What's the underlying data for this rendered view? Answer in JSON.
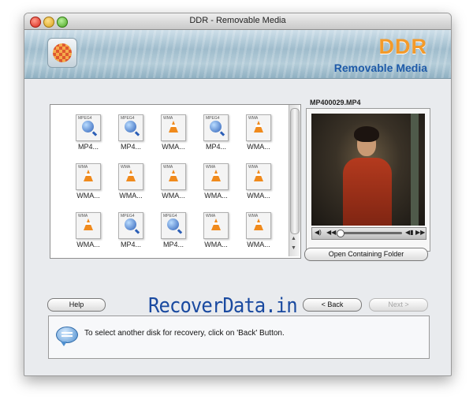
{
  "window": {
    "title": "DDR - Removable Media"
  },
  "header": {
    "brand": "DDR",
    "subtitle": "Removable Media"
  },
  "files": [
    {
      "label": "MP4...",
      "tag": "MPEG4",
      "type": "mp4"
    },
    {
      "label": "MP4...",
      "tag": "MPEG4",
      "type": "mp4"
    },
    {
      "label": "WMA...",
      "tag": "WMA",
      "type": "wma"
    },
    {
      "label": "MP4...",
      "tag": "MPEG4",
      "type": "mp4"
    },
    {
      "label": "WMA...",
      "tag": "WMA",
      "type": "wma"
    },
    {
      "label": "WMA...",
      "tag": "WMA",
      "type": "wma"
    },
    {
      "label": "WMA...",
      "tag": "WMA",
      "type": "wma"
    },
    {
      "label": "WMA...",
      "tag": "WMA",
      "type": "wma"
    },
    {
      "label": "WMA...",
      "tag": "WMA",
      "type": "wma"
    },
    {
      "label": "WMA...",
      "tag": "WMA",
      "type": "wma"
    },
    {
      "label": "WMA...",
      "tag": "WMA",
      "type": "wma"
    },
    {
      "label": "MP4...",
      "tag": "MPEG4",
      "type": "mp4"
    },
    {
      "label": "MP4...",
      "tag": "MPEG4",
      "type": "mp4"
    },
    {
      "label": "WMA...",
      "tag": "WMA",
      "type": "wma"
    },
    {
      "label": "WMA...",
      "tag": "WMA",
      "type": "wma"
    }
  ],
  "preview": {
    "filename": "MP400029.MP4"
  },
  "buttons": {
    "open_folder": "Open Containing Folder",
    "help": "Help",
    "back": "< Back",
    "next": "Next >"
  },
  "watermark": "RecoverData.in",
  "info": {
    "message": "To select another disk for recovery, click on 'Back' Button."
  }
}
